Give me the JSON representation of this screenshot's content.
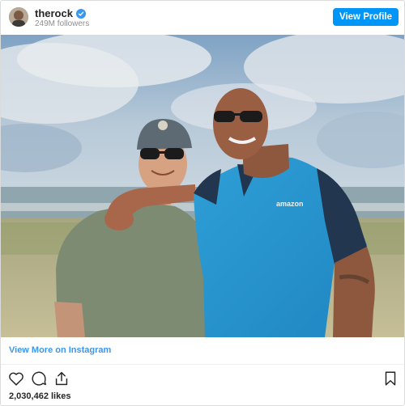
{
  "header": {
    "username": "therock",
    "followers": "249M followers",
    "view_profile_label": "View Profile",
    "verified_icon": "verified-badge-icon",
    "accent_color": "#0095f6"
  },
  "post": {
    "image_icon": "photo-of-two-men-on-beach",
    "view_more_label": "View More on Instagram",
    "shirt_text": "amazon",
    "link_color": "#3897f0"
  },
  "actions": {
    "icons": [
      "heart-icon",
      "comment-icon",
      "share-icon",
      "bookmark-icon"
    ],
    "likes": "2,030,462 likes"
  }
}
